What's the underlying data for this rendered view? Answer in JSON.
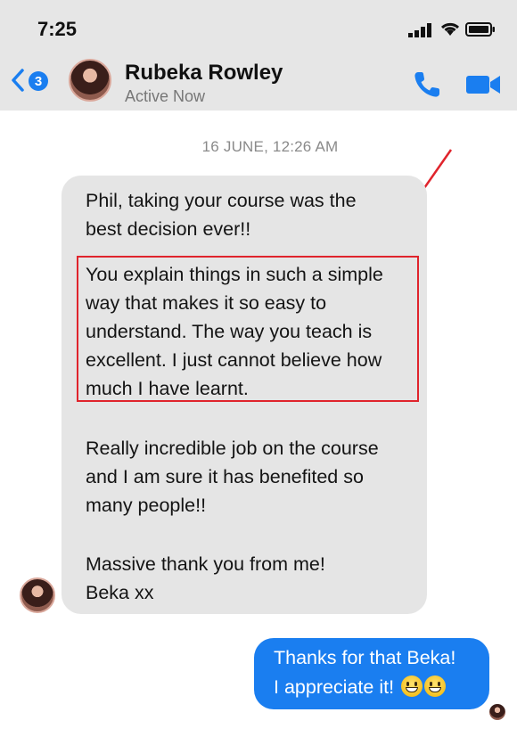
{
  "status_bar": {
    "time": "7:25"
  },
  "header": {
    "back_count": "3",
    "contact_name": "Rubeka Rowley",
    "contact_status": "Active Now",
    "icons": {
      "back": "chevron-left-icon",
      "call": "phone-icon",
      "video": "video-camera-icon"
    },
    "accent_color": "#1a7ef0"
  },
  "conversation": {
    "timestamp": "16 JUNE, 12:26 AM",
    "incoming": {
      "paragraphs": [
        "Phil, taking your course was the\nbest decision ever!!",
        "You explain things in such a simple\nway that makes it so easy to\nunderstand. The way you teach is\nexcellent. I just cannot believe how\nmuch I have learnt.",
        "Really incredible job on the course\nand I am sure it has benefited so\nmany people!!",
        "Massive thank you from me!\nBeka xx"
      ],
      "highlight_color": "#e0242c"
    },
    "outgoing": {
      "line1": "Thanks for that Beka!",
      "line2": "I appreciate it!"
    }
  }
}
